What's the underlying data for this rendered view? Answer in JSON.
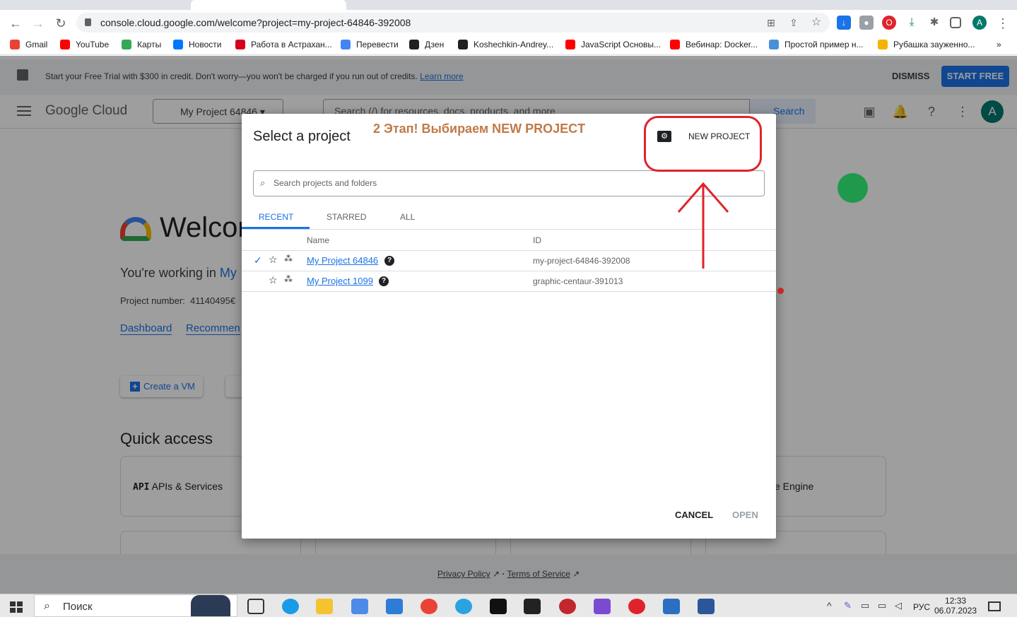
{
  "browser": {
    "url": "console.cloud.google.com/welcome?project=my-project-64846-392008",
    "profile_initial": "A",
    "bookmarks": [
      "Gmail",
      "YouTube",
      "Карты",
      "Новости",
      "Работа в Астрахан...",
      "Перевести",
      "Дзен",
      "Koshechkin-Andrey...",
      "JavaScript Основы...",
      "Вебинар: Docker...",
      "Простой пример н...",
      "Рубашка зауженно..."
    ],
    "bookmark_colors": [
      "#ea4335",
      "#ff0000",
      "#34a853",
      "#0077ff",
      "#d6001c",
      "#4285f4",
      "#202124",
      "#202124",
      "#ff0000",
      "#ff0000",
      "#4a90d9",
      "#f4b400"
    ],
    "more": "»"
  },
  "promo": {
    "text": "Start your Free Trial with $300 in credit. Don't worry—you won't be charged if you run out of credits.",
    "link": "Learn more",
    "dismiss": "DISMISS",
    "start": "START FREE"
  },
  "header": {
    "logo": "Google Cloud",
    "project": "My Project 64846",
    "search_placeholder": "Search (/) for resources, docs, products, and more",
    "search_button": "Search",
    "avatar": "A"
  },
  "main": {
    "welcome": "Welcom",
    "working_in": "You're working in",
    "working_project": "My",
    "project_number_label": "Project number:",
    "project_number": "41140495€",
    "links": [
      "Dashboard",
      "Recommen"
    ],
    "create_vm": "Create a VM",
    "quick_access": "Quick access",
    "api_card": "APIs & Services",
    "engine_card": "e Engine"
  },
  "footer": {
    "privacy": "Privacy Policy",
    "separator": "·",
    "terms": "Terms of Service"
  },
  "dialog": {
    "title": "Select a project",
    "new_project": "NEW PROJECT",
    "search_placeholder": "Search projects and folders",
    "tabs": [
      "RECENT",
      "STARRED",
      "ALL"
    ],
    "columns": [
      "Name",
      "ID"
    ],
    "rows": [
      {
        "name": "My Project 64846",
        "id": "my-project-64846-392008",
        "selected": true
      },
      {
        "name": "My Project 1099",
        "id": "graphic-centaur-391013",
        "selected": false
      }
    ],
    "cancel": "CANCEL",
    "open": "OPEN"
  },
  "annotation": {
    "text": "2 Этап! Выбираем NEW PROJECT",
    "color": "#e0232b"
  },
  "taskbar": {
    "search": "Поиск",
    "lang": "РУС",
    "time": "12:33",
    "date": "06.07.2023"
  }
}
